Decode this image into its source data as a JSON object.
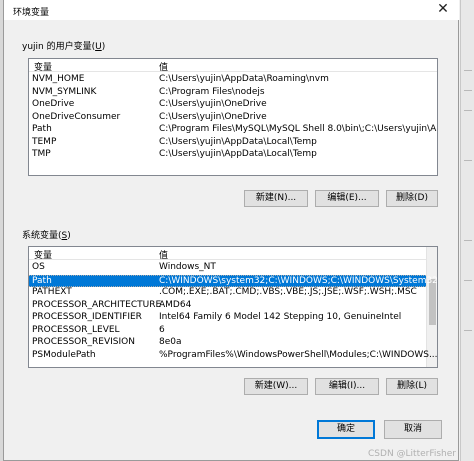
{
  "window": {
    "title": "环境变量",
    "close_glyph": "✕"
  },
  "user_section": {
    "label_prefix": "yujin 的用户变量(",
    "label_key": "U",
    "label_suffix": ")",
    "columns": [
      "变量",
      "值"
    ],
    "rows": [
      [
        "NVM_HOME",
        "C:\\Users\\yujin\\AppData\\Roaming\\nvm"
      ],
      [
        "NVM_SYMLINK",
        "C:\\Program Files\\nodejs"
      ],
      [
        "OneDrive",
        "C:\\Users\\yujin\\OneDrive"
      ],
      [
        "OneDriveConsumer",
        "C:\\Users\\yujin\\OneDrive"
      ],
      [
        "Path",
        "C:\\Program Files\\MySQL\\MySQL Shell 8.0\\bin\\;C:\\Users\\yujin\\A..."
      ],
      [
        "TEMP",
        "C:\\Users\\yujin\\AppData\\Local\\Temp"
      ],
      [
        "TMP",
        "C:\\Users\\yujin\\AppData\\Local\\Temp"
      ]
    ],
    "buttons": {
      "new": "新建(N)...",
      "edit": "编辑(E)...",
      "delete": "删除(D)"
    }
  },
  "system_section": {
    "label_prefix": "系统变量(",
    "label_key": "S",
    "label_suffix": ")",
    "columns": [
      "变量",
      "值"
    ],
    "rows": [
      [
        "OS",
        "Windows_NT"
      ],
      [
        "Path",
        "C:\\WINDOWS\\system32;C:\\WINDOWS;C:\\WINDOWS\\System32\\..."
      ],
      [
        "PATHEXT",
        ".COM;.EXE;.BAT;.CMD;.VBS;.VBE;.JS;.JSE;.WSF;.WSH;.MSC"
      ],
      [
        "PROCESSOR_ARCHITECTURE",
        "AMD64"
      ],
      [
        "PROCESSOR_IDENTIFIER",
        "Intel64 Family 6 Model 142 Stepping 10, GenuineIntel"
      ],
      [
        "PROCESSOR_LEVEL",
        "6"
      ],
      [
        "PROCESSOR_REVISION",
        "8e0a"
      ],
      [
        "PSModulePath",
        "%ProgramFiles%\\WindowsPowerShell\\Modules;C:\\WINDOWS..."
      ]
    ],
    "selected_index": 1,
    "buttons": {
      "new": "新建(W)...",
      "edit": "编辑(I)...",
      "delete": "删除(L)"
    }
  },
  "footer": {
    "ok": "确定",
    "cancel": "取消"
  },
  "watermark": "CSDN @LitterFisher"
}
